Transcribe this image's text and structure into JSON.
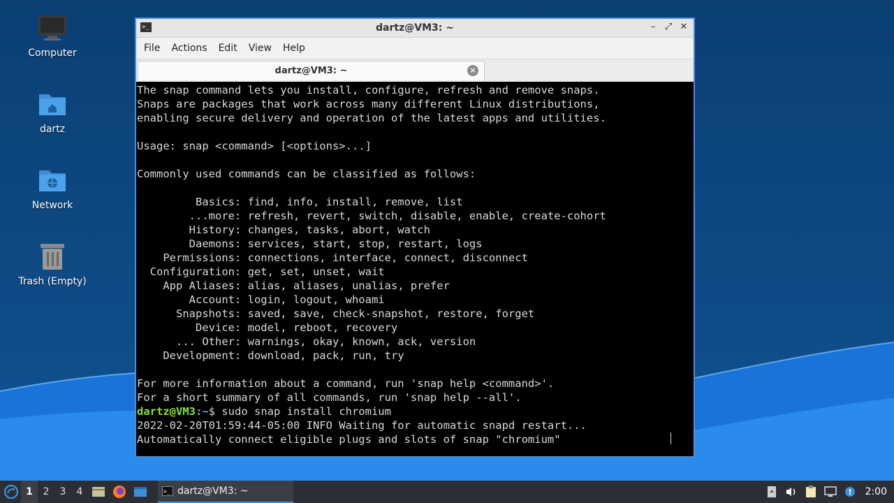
{
  "desktop": {
    "icons": [
      {
        "label": "Computer"
      },
      {
        "label": "dartz"
      },
      {
        "label": "Network"
      },
      {
        "label": "Trash (Empty)"
      }
    ]
  },
  "window": {
    "title": "dartz@VM3: ~",
    "menu": [
      "File",
      "Actions",
      "Edit",
      "View",
      "Help"
    ],
    "tab_label": "dartz@VM3: ~",
    "terminal_lines": [
      "The snap command lets you install, configure, refresh and remove snaps.",
      "Snaps are packages that work across many different Linux distributions,",
      "enabling secure delivery and operation of the latest apps and utilities.",
      "",
      "Usage: snap <command> [<options>...]",
      "",
      "Commonly used commands can be classified as follows:",
      "",
      "         Basics: find, info, install, remove, list",
      "        ...more: refresh, revert, switch, disable, enable, create-cohort",
      "        History: changes, tasks, abort, watch",
      "        Daemons: services, start, stop, restart, logs",
      "    Permissions: connections, interface, connect, disconnect",
      "  Configuration: get, set, unset, wait",
      "    App Aliases: alias, aliases, unalias, prefer",
      "        Account: login, logout, whoami",
      "      Snapshots: saved, save, check-snapshot, restore, forget",
      "         Device: model, reboot, recovery",
      "      ... Other: warnings, okay, known, ack, version",
      "    Development: download, pack, run, try",
      "",
      "For more information about a command, run 'snap help <command>'.",
      "For a short summary of all commands, run 'snap help --all'."
    ],
    "prompt": {
      "user": "dartz@VM3",
      "path": ":~",
      "symbol": "$ ",
      "command": "sudo snap install chromium"
    },
    "output_after": [
      "2022-02-20T01:59:44-05:00 INFO Waiting for automatic snapd restart...",
      "Automatically connect eligible plugs and slots of snap \"chromium\""
    ]
  },
  "taskbar": {
    "workspaces": [
      "1",
      "2",
      "3",
      "4"
    ],
    "active_workspace": "1",
    "task_label": "dartz@VM3: ~",
    "clock": "2:00"
  },
  "colors": {
    "accent": "#4a90d9",
    "prompt_user": "#8ae234",
    "prompt_path": "#729fcf"
  }
}
